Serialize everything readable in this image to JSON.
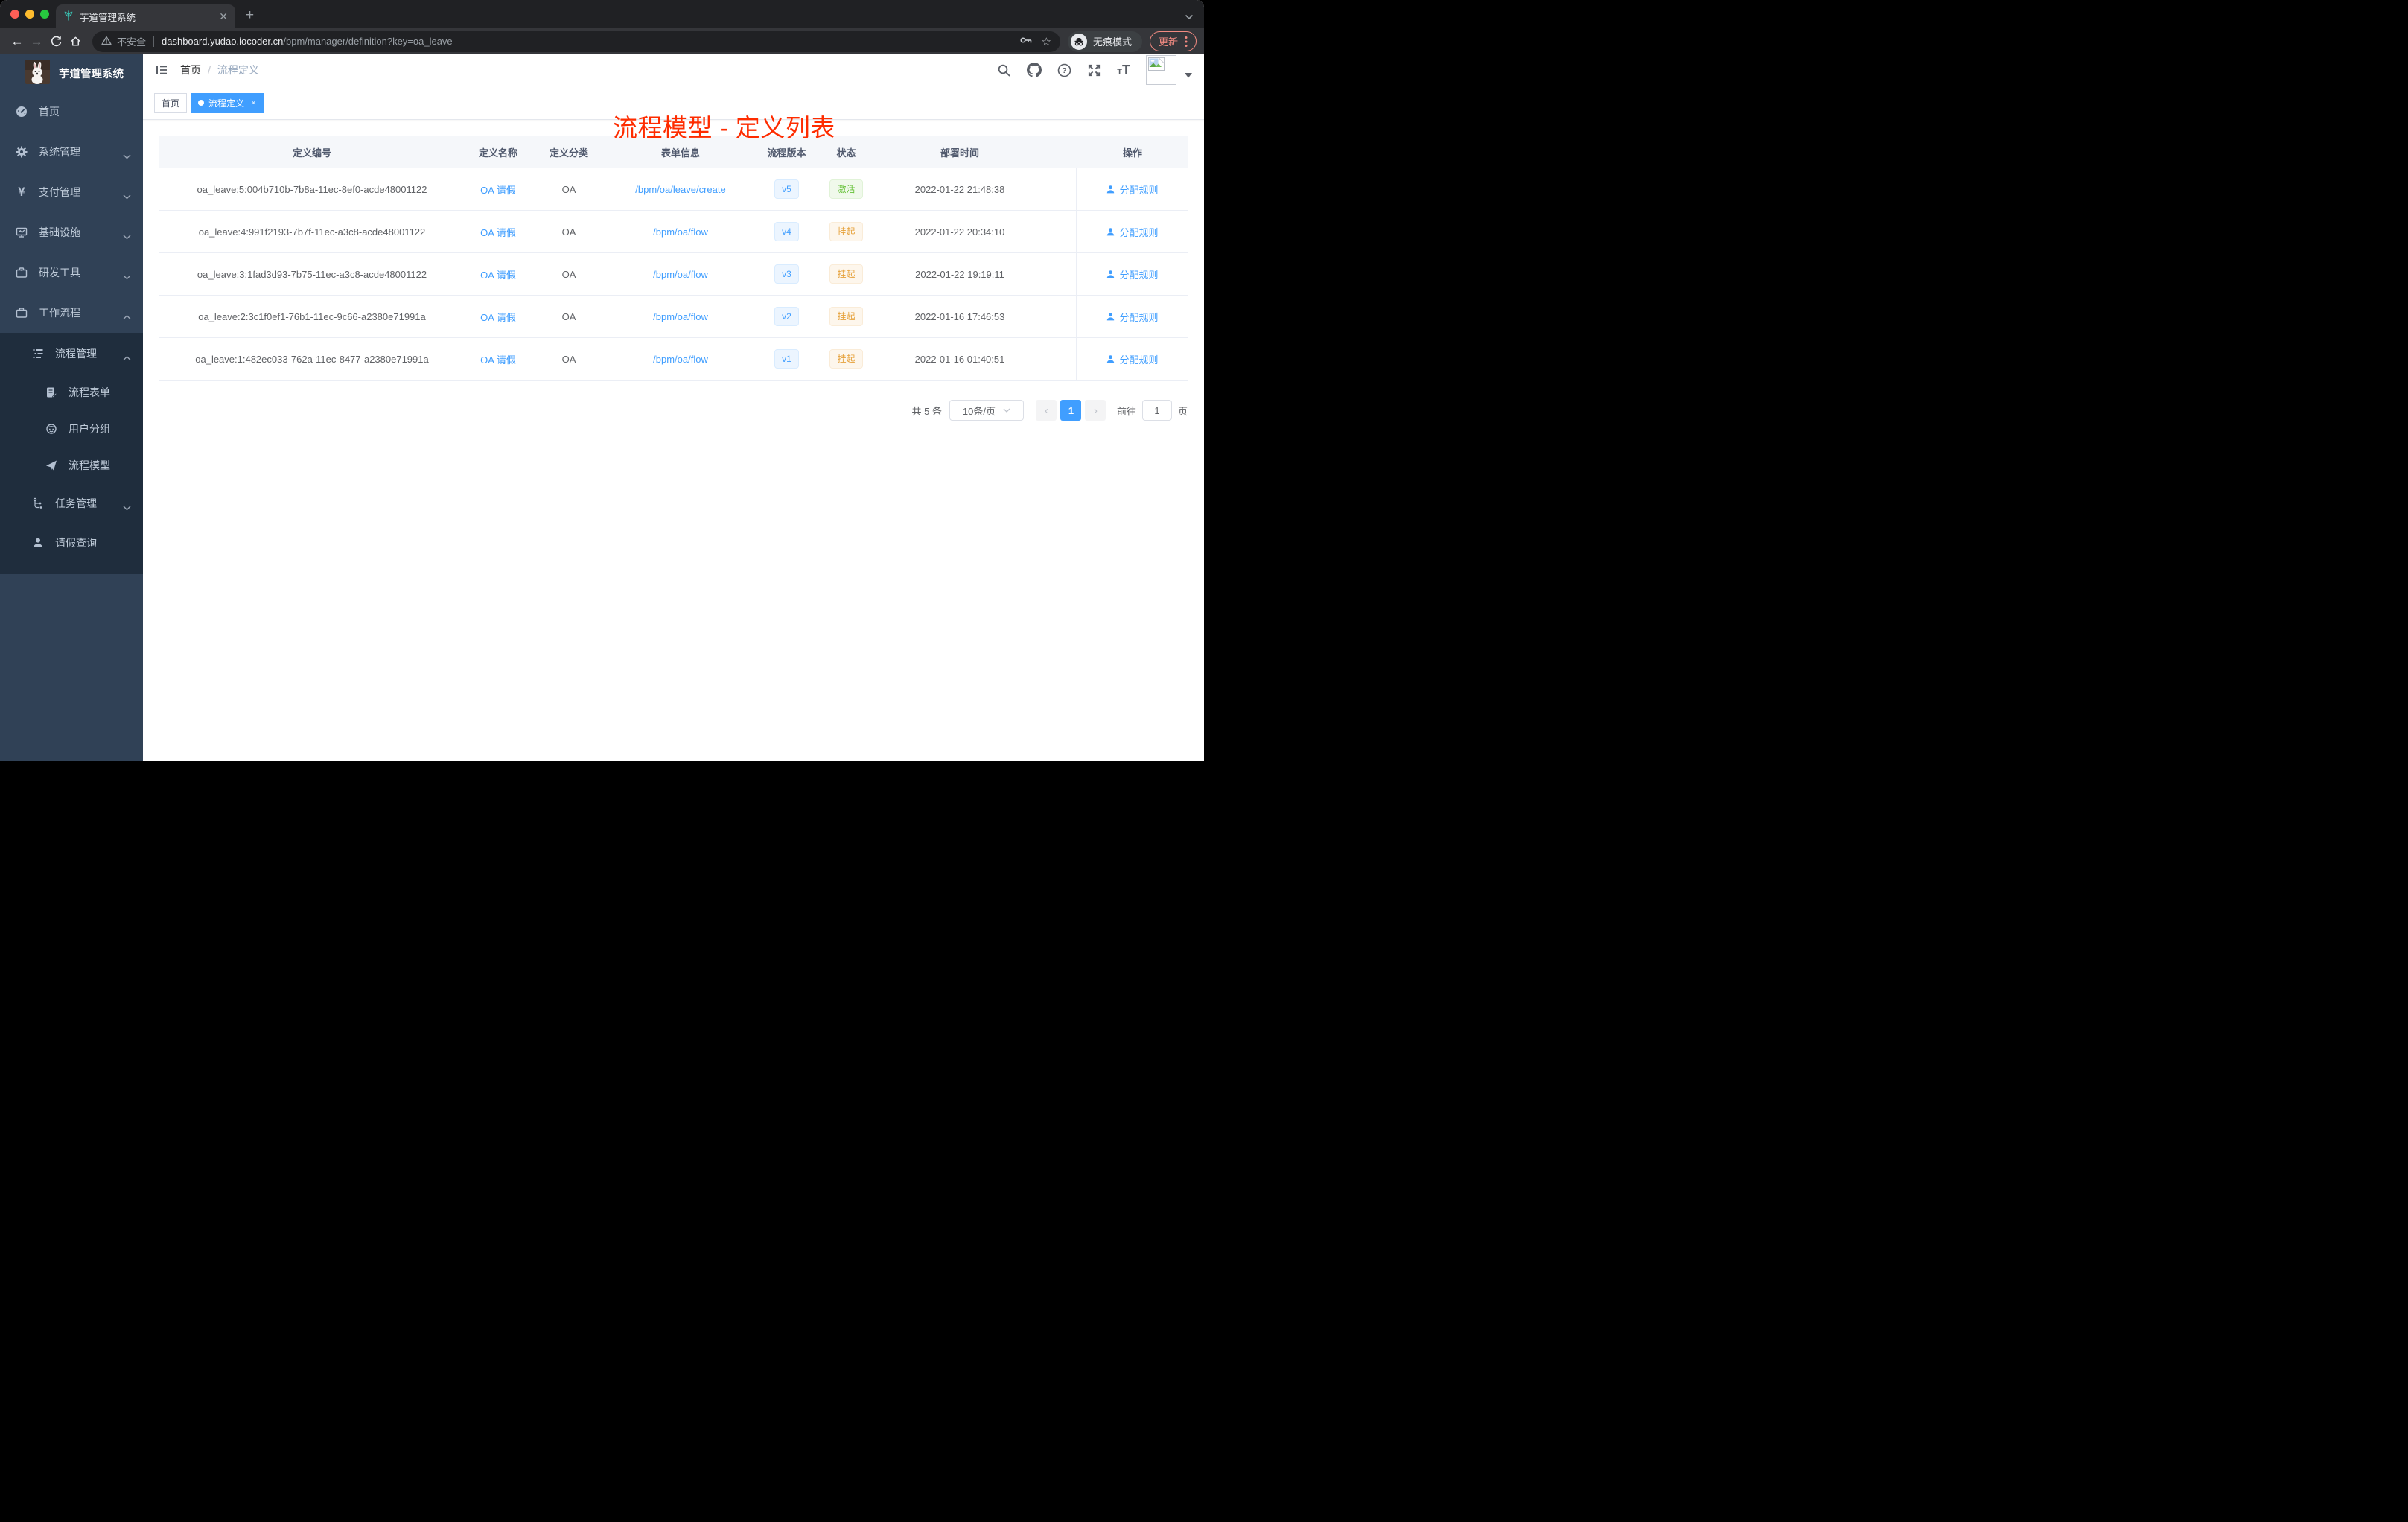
{
  "browser": {
    "tab_title": "芋道管理系统",
    "security": "不安全",
    "url_host": "dashboard.yudao.iocoder.cn",
    "url_path": "/bpm/manager/definition?key=oa_leave",
    "incognito": "无痕模式",
    "update": "更新"
  },
  "sidebar": {
    "app_title": "芋道管理系统",
    "items": [
      {
        "label": "首页"
      },
      {
        "label": "系统管理"
      },
      {
        "label": "支付管理"
      },
      {
        "label": "基础设施"
      },
      {
        "label": "研发工具"
      },
      {
        "label": "工作流程"
      },
      {
        "label": "流程管理"
      },
      {
        "label": "流程表单"
      },
      {
        "label": "用户分组"
      },
      {
        "label": "流程模型"
      },
      {
        "label": "任务管理"
      },
      {
        "label": "请假查询"
      }
    ]
  },
  "header": {
    "breadcrumb_home": "首页",
    "breadcrumb_sep": "/",
    "breadcrumb_current": "流程定义",
    "annotation": "流程模型 - 定义列表"
  },
  "tags": [
    {
      "label": "首页",
      "active": false
    },
    {
      "label": "流程定义",
      "active": true
    }
  ],
  "table": {
    "columns": [
      "定义编号",
      "定义名称",
      "定义分类",
      "表单信息",
      "流程版本",
      "状态",
      "部署时间",
      "操作"
    ],
    "rows": [
      {
        "id": "oa_leave:5:004b710b-7b8a-11ec-8ef0-acde48001122",
        "name": "OA 请假",
        "category": "OA",
        "form": "/bpm/oa/leave/create",
        "version": "v5",
        "status": "激活",
        "status_type": "success",
        "time": "2022-01-22 21:48:38",
        "action": "分配规则"
      },
      {
        "id": "oa_leave:4:991f2193-7b7f-11ec-a3c8-acde48001122",
        "name": "OA 请假",
        "category": "OA",
        "form": "/bpm/oa/flow",
        "version": "v4",
        "status": "挂起",
        "status_type": "warning",
        "time": "2022-01-22 20:34:10",
        "action": "分配规则"
      },
      {
        "id": "oa_leave:3:1fad3d93-7b75-11ec-a3c8-acde48001122",
        "name": "OA 请假",
        "category": "OA",
        "form": "/bpm/oa/flow",
        "version": "v3",
        "status": "挂起",
        "status_type": "warning",
        "time": "2022-01-22 19:19:11",
        "action": "分配规则"
      },
      {
        "id": "oa_leave:2:3c1f0ef1-76b1-11ec-9c66-a2380e71991a",
        "name": "OA 请假",
        "category": "OA",
        "form": "/bpm/oa/flow",
        "version": "v2",
        "status": "挂起",
        "status_type": "warning",
        "time": "2022-01-16 17:46:53",
        "action": "分配规则"
      },
      {
        "id": "oa_leave:1:482ec033-762a-11ec-8477-a2380e71991a",
        "name": "OA 请假",
        "category": "OA",
        "form": "/bpm/oa/flow",
        "version": "v1",
        "status": "挂起",
        "status_type": "warning",
        "time": "2022-01-16 01:40:51",
        "action": "分配规则"
      }
    ]
  },
  "pagination": {
    "total": "共 5 条",
    "page_size": "10条/页",
    "current": "1",
    "goto_label": "前往",
    "goto_value": "1",
    "page_unit": "页"
  },
  "colors": {
    "accent": "#409eff",
    "success": "#67c23a",
    "warning": "#e6a23c",
    "annotation_red": "#fe2c00",
    "sidebar_bg": "#304156",
    "submenu_bg": "#1f2d3d"
  }
}
